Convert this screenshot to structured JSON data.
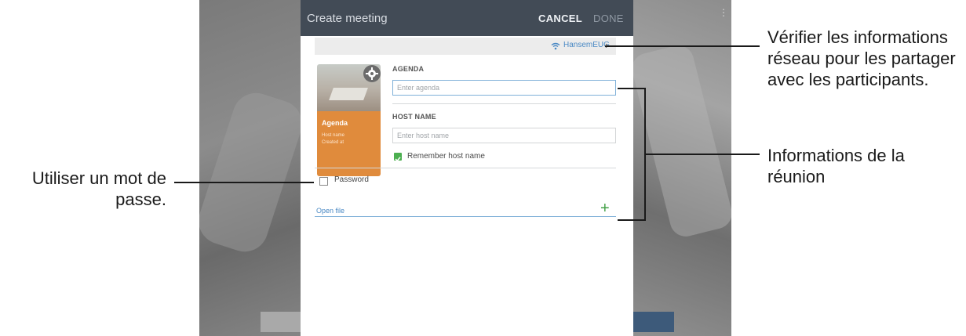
{
  "dialog": {
    "title": "Create meeting",
    "cancel_label": "CANCEL",
    "done_label": "DONE",
    "network_name": "HansemEUG",
    "agenda_label": "AGENDA",
    "agenda_placeholder": "Enter agenda",
    "host_label": "HOST NAME",
    "host_placeholder": "Enter host name",
    "remember_label": "Remember host name",
    "remember_checked": true,
    "password_label": "Password",
    "password_checked": false,
    "open_file_label": "Open file",
    "thumbnail": {
      "title": "Agenda",
      "line1": "Host name",
      "line2": "Created at"
    }
  },
  "callouts": {
    "network": "Vérifier les informations réseau pour les partager avec les participants.",
    "meeting": "Informations de la réunion",
    "password": "Utiliser un mot de passe."
  },
  "colors": {
    "header": "#424b56",
    "accent_blue": "#4a89c4",
    "check_green": "#4caf50",
    "thumbnail_orange": "#e08b3c"
  }
}
